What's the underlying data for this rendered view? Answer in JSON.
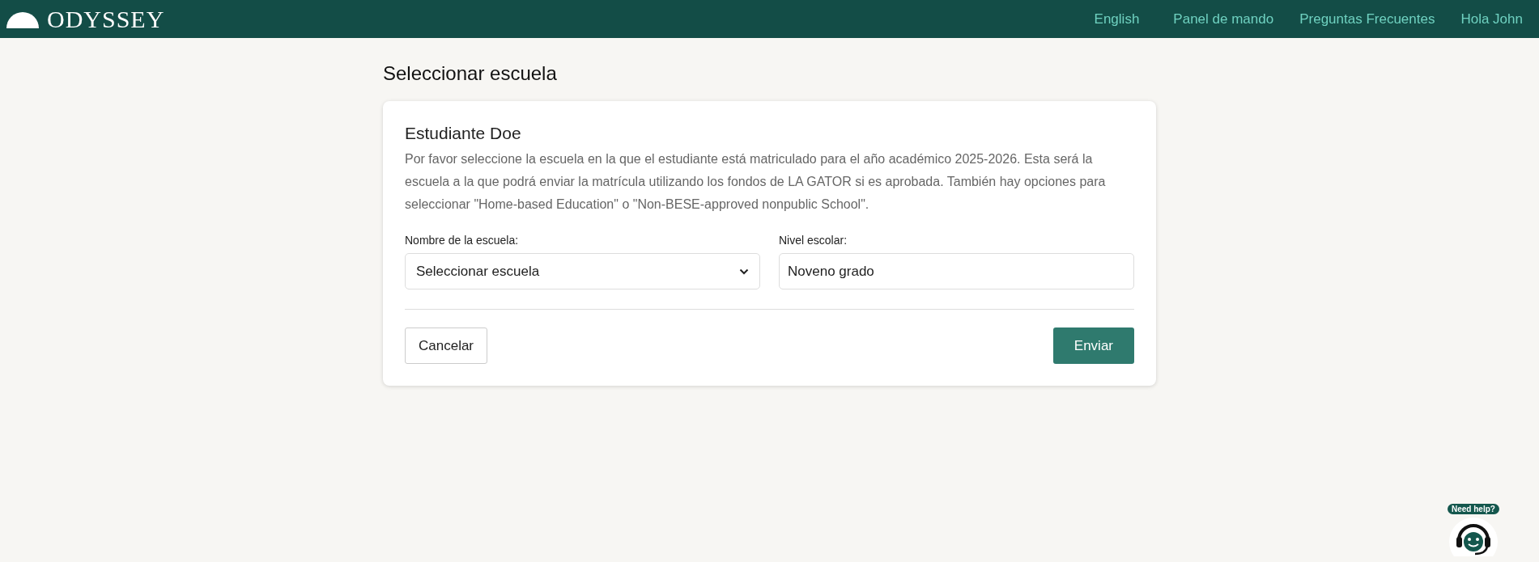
{
  "header": {
    "logo": "ODYSSEY",
    "nav": [
      {
        "label": "English"
      },
      {
        "label": "Panel de mando"
      },
      {
        "label": "Preguntas Frecuentes"
      },
      {
        "label": "Hola John"
      }
    ]
  },
  "page_title": "Seleccionar escuela",
  "card": {
    "student": "Estudiante Doe",
    "description": "Por favor seleccione la escuela en la que el estudiante está matriculado para el año académico 2025-2026. Esta será la escuela a la que podrá enviar la matrícula utilizando los fondos de LA GATOR si es aprobada. También hay opciones para seleccionar \"Home-based Education\" o \"Non-BESE-approved nonpublic School\".",
    "fields": [
      {
        "kind": "select",
        "label": "Nombre de la escuela:",
        "value": "Seleccionar escuela"
      },
      {
        "kind": "text",
        "label": "Nivel escolar:",
        "value": "Noveno grado"
      }
    ],
    "cancel": "Cancelar",
    "submit": "Enviar"
  },
  "help": {
    "label": "Need help?"
  }
}
